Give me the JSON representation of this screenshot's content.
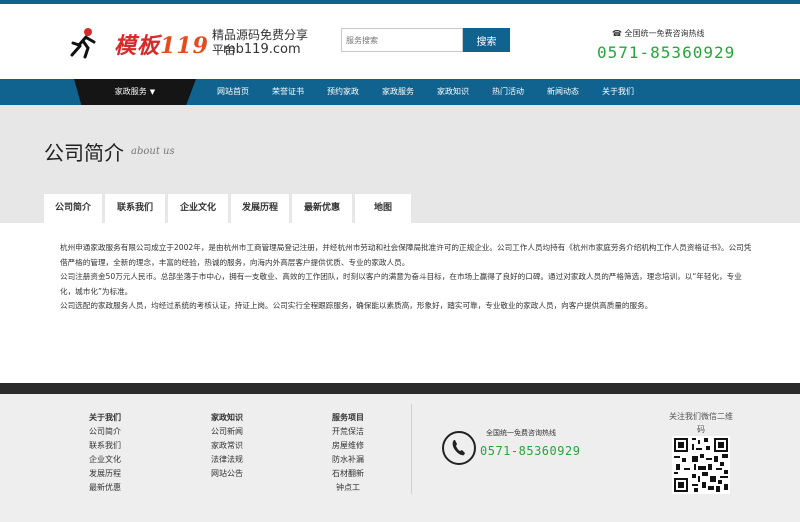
{
  "header": {
    "logo_text": "模板",
    "logo_num": "119",
    "slogan": "精品源码免费分享平台",
    "url": "mb119.com",
    "search_placeholder": "服务搜索",
    "search_button": "搜索",
    "hotline_label": "全国统一免费咨询热线",
    "hotline_number": "0571-85360929"
  },
  "nav": {
    "dropdown": "家政服务",
    "items": [
      "网站首页",
      "荣誉证书",
      "预约家政",
      "家政服务",
      "家政知识",
      "热门活动",
      "新闻动态",
      "关于我们"
    ]
  },
  "banner": {
    "title": "公司简介",
    "subtitle": "about us"
  },
  "tabs": [
    "公司简介",
    "联系我们",
    "企业文化",
    "发展历程",
    "最新优惠",
    "地图"
  ],
  "content": {
    "p1": "杭州申通家政服务有限公司成立于2002年，是由杭州市工商管理局登记注册，并经杭州市劳动和社会保障局批准许可的正规企业。公司工作人员均持有《杭州市家庭劳务介绍机构工作人员资格证书》。公司凭借严格的管理，全新的理念，丰富的经验，热诚的服务，向海内外高层客户提供优质、专业的家政人员。",
    "p2": "公司注册资金50万元人民币。总部坐落于市中心，拥有一支敬业、高效的工作团队，时刻以客户的满意为奋斗目标，在市场上赢得了良好的口碑。通过对家政人员的严格筛选，理念培训，以“年轻化，专业化，城市化”为标准。",
    "p3": "公司选配的家政服务人员，均经过系统的考核认证，持证上岗。公司实行全程跟踪服务，确保能以素质高，形象好，踏实可靠，专业敬业的家政人员，向客户提供高质量的服务。"
  },
  "footer": {
    "col1": {
      "title": "关于我们",
      "items": [
        "公司简介",
        "联系我们",
        "企业文化",
        "发展历程",
        "最新优惠"
      ]
    },
    "col2": {
      "title": "家政知识",
      "items": [
        "公司新闻",
        "家政常识",
        "法律法规",
        "网站公告"
      ]
    },
    "col3": {
      "title": "服务项目",
      "items": [
        "开荒保洁",
        "房屋维修",
        "防水补漏",
        "石材翻新",
        "钟点工"
      ]
    },
    "hotline_label": "全国统一免费咨询热线",
    "hotline_number": "0571-85360929",
    "qr_label": "关注我们微信二维码"
  },
  "colors": {
    "primary": "#10638e",
    "accent_green": "#26a63a",
    "dark": "#151515"
  }
}
